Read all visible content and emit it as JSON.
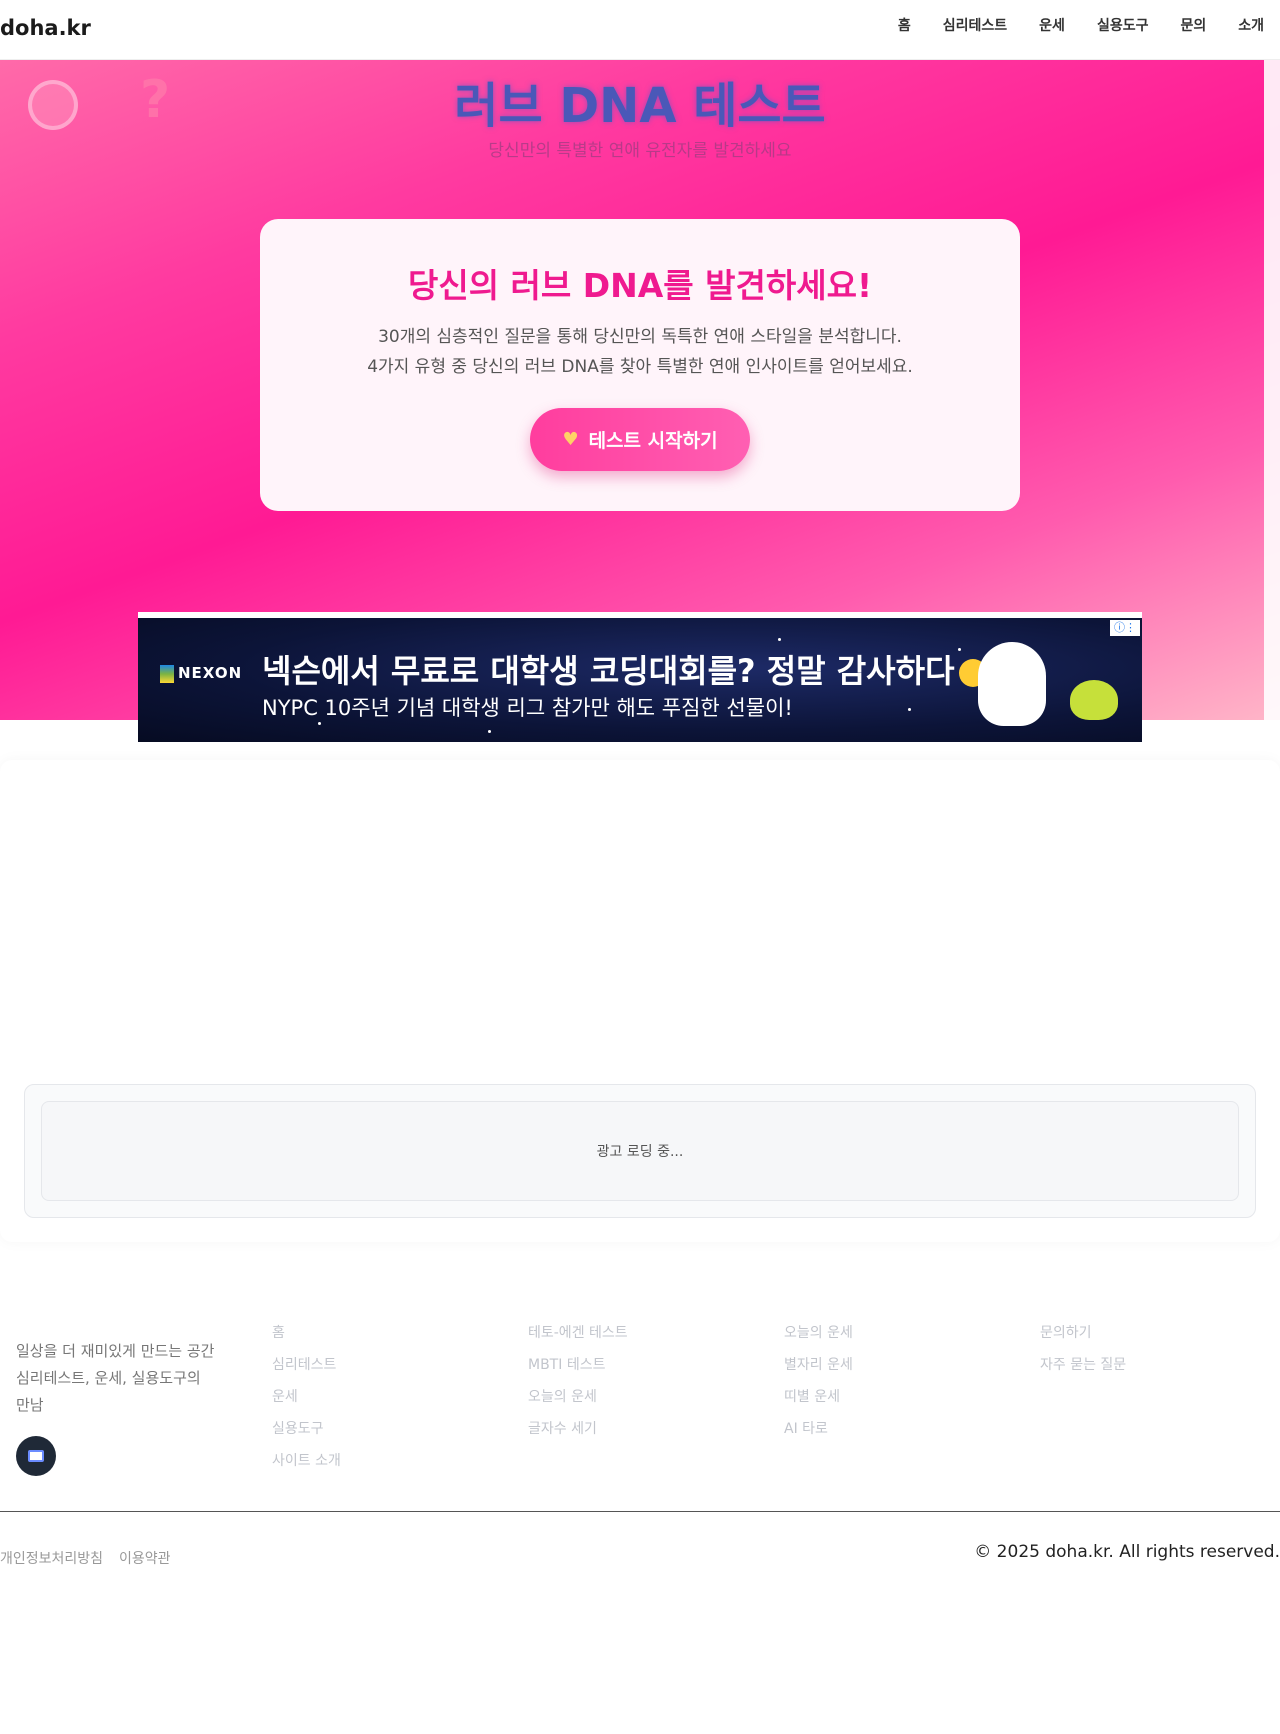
{
  "header": {
    "logo": "doha.kr",
    "nav": [
      "홈",
      "심리테스트",
      "운세",
      "실용도구",
      "문의",
      "소개"
    ]
  },
  "hero": {
    "title": "러브 DNA 테스트",
    "subtitle": "당신만의 특별한 연애 유전자를 발견하세요",
    "card": {
      "title": "당신의 러브 DNA를 발견하세요!",
      "line1": "30개의 심층적인 질문을 통해 당신만의 독특한 연애 스타일을 분석합니다.",
      "line2": "4가지 유형 중 당신의 러브 DNA를 찾아 특별한 연애 인사이트를 얻어보세요.",
      "button_label": "테스트 시작하기",
      "button_icon": "heart-icon"
    }
  },
  "ad_banner": {
    "brand": "NEXON",
    "headline": "넥슨에서 무료로 대학생 코딩대회를? 정말 감사하다",
    "subline": "NYPC 10주년 기념 대학생 리그 참가만 해도 푸짐한 선물이!",
    "ad_choice_icon": "adchoices-icon"
  },
  "ad_slot": {
    "loading_text": "광고 로딩 중..."
  },
  "footer": {
    "tagline_1": "일상을 더 재미있게 만드는 공간",
    "tagline_2": "심리테스트, 운세, 실용도구의",
    "tagline_3": "만남",
    "columns": [
      [
        "홈",
        "심리테스트",
        "운세",
        "실용도구",
        "사이트 소개"
      ],
      [
        "테토-에겐 테스트",
        "MBTI 테스트",
        "오늘의 운세",
        "글자수 세기"
      ],
      [
        "오늘의 운세",
        "별자리 운세",
        "띠별 운세",
        "AI 타로"
      ],
      [
        "문의하기",
        "자주 묻는 질문"
      ]
    ],
    "legal": [
      "개인정보처리방침",
      "이용약관"
    ],
    "copyright": "© 2025 doha.kr. All rights reserved."
  },
  "colors": {
    "accent": "#ef1a8f",
    "hero_gradient_mid": "#ff1a94",
    "button": "#ff3d9e"
  }
}
